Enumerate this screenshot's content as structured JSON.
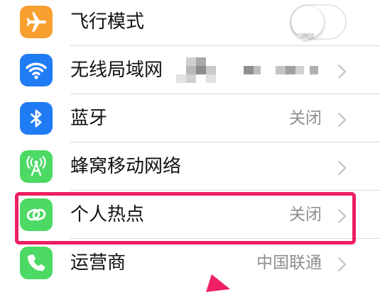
{
  "settings": {
    "rows": [
      {
        "id": "airplane",
        "label": "飞行模式",
        "value": "",
        "control": "toggle",
        "toggle_state": "off",
        "icon": "airplane-icon",
        "icon_color": "#f7a030"
      },
      {
        "id": "wifi",
        "label": "无线局域网",
        "value": "",
        "control": "chevron",
        "value_redacted": true,
        "icon": "wifi-icon",
        "icon_color": "#1f7cf5"
      },
      {
        "id": "bluetooth",
        "label": "蓝牙",
        "value": "关闭",
        "control": "chevron",
        "icon": "bluetooth-icon",
        "icon_color": "#1f7cf5"
      },
      {
        "id": "cellular",
        "label": "蜂窝移动网络",
        "value": "",
        "control": "chevron",
        "icon": "cellular-antenna-icon",
        "icon_color": "#4cd964"
      },
      {
        "id": "hotspot",
        "label": "个人热点",
        "value": "关闭",
        "control": "chevron",
        "icon": "hotspot-link-icon",
        "icon_color": "#4cd964",
        "highlighted": true
      },
      {
        "id": "carrier",
        "label": "运营商",
        "value": "中国联通",
        "control": "chevron",
        "icon": "phone-icon",
        "icon_color": "#4cd964"
      }
    ]
  },
  "annotation": {
    "highlight_color": "#ee1f63",
    "highlighted_row": "hotspot",
    "arrow": "pink-arrow"
  }
}
